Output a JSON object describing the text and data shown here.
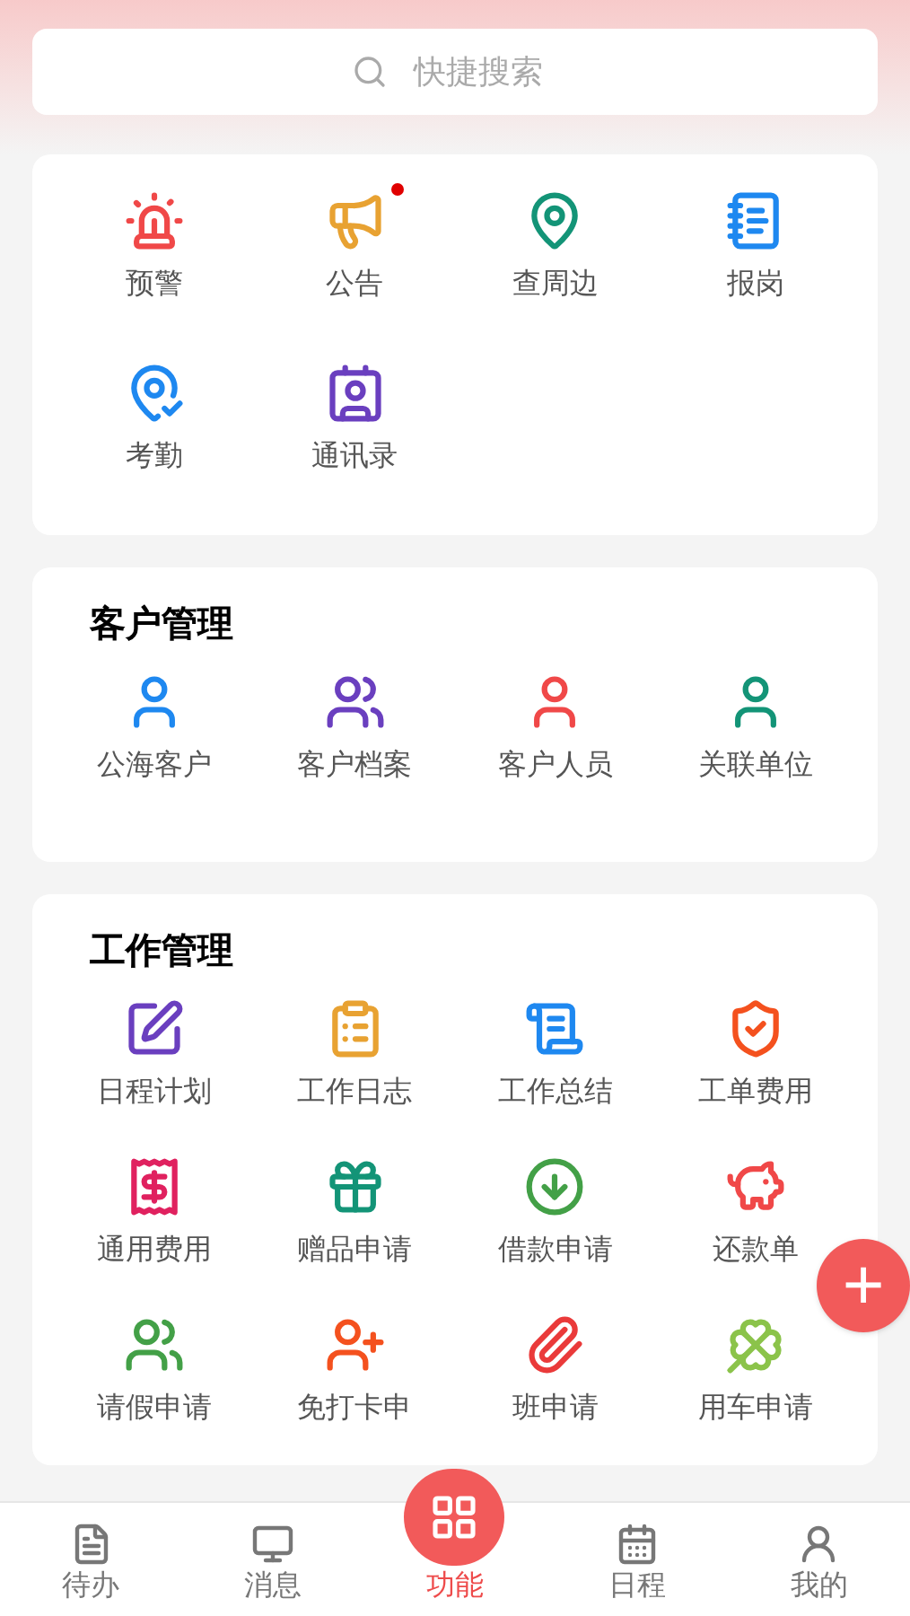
{
  "search": {
    "placeholder": "快捷搜索"
  },
  "quick": [
    {
      "label": "预警",
      "dot": false
    },
    {
      "label": "公告",
      "dot": true
    },
    {
      "label": "查周边",
      "dot": false
    },
    {
      "label": "报岗",
      "dot": false
    },
    {
      "label": "考勤",
      "dot": false
    },
    {
      "label": "通讯录",
      "dot": false
    }
  ],
  "sections": [
    {
      "title": "客户管理",
      "items": [
        {
          "label": "公海客户"
        },
        {
          "label": "客户档案"
        },
        {
          "label": "客户人员"
        },
        {
          "label": "关联单位"
        }
      ]
    },
    {
      "title": "工作管理",
      "items": [
        {
          "label": "日程计划"
        },
        {
          "label": "工作日志"
        },
        {
          "label": "工作总结"
        },
        {
          "label": "工单费用"
        },
        {
          "label": "通用费用"
        },
        {
          "label": "赠品申请"
        },
        {
          "label": "借款申请"
        },
        {
          "label": "还款单"
        },
        {
          "label": "请假申请"
        },
        {
          "label": "免打卡申"
        },
        {
          "label": "班申请"
        },
        {
          "label": "用车申请"
        }
      ]
    }
  ],
  "fab": {
    "label": "+"
  },
  "tabs": [
    {
      "label": "待办",
      "kind": "plain",
      "selected": false
    },
    {
      "label": "消息",
      "kind": "plain",
      "selected": false
    },
    {
      "label": "功能",
      "kind": "center",
      "selected": true
    },
    {
      "label": "日程",
      "kind": "plain",
      "selected": false
    },
    {
      "label": "我的",
      "kind": "plain",
      "selected": false
    }
  ]
}
